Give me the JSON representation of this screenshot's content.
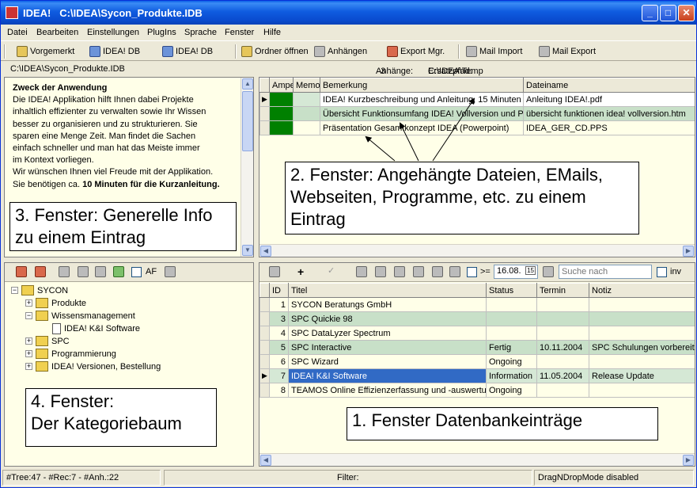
{
  "window": {
    "app_name": "IDEA!",
    "file_path": "C:\\IDEA\\Sycon_Produkte.IDB",
    "minimize": "_",
    "maximize": "□",
    "close": "✕"
  },
  "menu": [
    "Datei",
    "Bearbeiten",
    "Einstellungen",
    "PlugIns",
    "Sprache",
    "Fenster",
    "Hilfe"
  ],
  "toolbar": {
    "vorgemerkt": "Vorgemerkt",
    "idea_db_1": "IDEA! DB",
    "idea_db_2": "IDEA! DB",
    "ordner_oeffnen": "Ordner öffnen",
    "anhaengen": "Anhängen",
    "export_mgr": "Export Mgr.",
    "mail_import": "Mail Import",
    "mail_export": "Mail Export"
  },
  "infobar": {
    "path": "C:\\IDEA\\Sycon_Produkte.IDB",
    "anhaenge_label": "Anhänge:",
    "anhaenge_count": "3",
    "ersatzpfad_label": "Ersatzpfad:",
    "ersatzpfad_value": "C:\\IDEA\\Temp"
  },
  "notes": {
    "heading": "Zweck der Anwendung",
    "lines": [
      "Die IDEA! Applikation hilft Ihnen dabei Projekte",
      "inhaltlich effizienter zu verwalten sowie Ihr Wissen",
      "besser zu organisieren und zu strukturieren. Sie",
      "sparen eine Menge Zeit. Man findet die Sachen",
      "einfach schneller und man hat das Meiste immer",
      "im Kontext vorliegen.",
      "Wir wünschen Ihnen viel Freude mit der Applikation."
    ],
    "last_line_prefix": "Sie benötigen ca. ",
    "last_line_bold": "10 Minuten für die Kurzanleitung."
  },
  "attachments": {
    "columns": [
      "Ampel",
      "Memo",
      "Bemerkung",
      "Dateiname"
    ],
    "rows": [
      {
        "bemerkung": "IDEA! Kurzbeschreibung und Anleitung, 15 Minuten",
        "dateiname": "Anleitung IDEA!.pdf"
      },
      {
        "bemerkung": "Übersicht Funktionsumfang IDEA! Vollversion und Pre",
        "dateiname": "übersicht funktionen idea! vollversion.htm"
      },
      {
        "bemerkung": "Präsentation Gesamtkonzept IDEA (Powerpoint)",
        "dateiname": "IDEA_GER_CD.PPS"
      }
    ]
  },
  "callouts": {
    "fenster1": "1. Fenster Datenbankeinträge",
    "fenster2_l1": "2. Fenster: Angehängte Dateien, EMails,",
    "fenster2_l2": "Webseiten, Programme, etc. zu einem",
    "fenster2_l3": "Eintrag",
    "fenster3_l1": "3. Fenster: Generelle Info",
    "fenster3_l2": "zu einem Eintrag",
    "fenster4_l1": "4. Fenster:",
    "fenster4_l2": "Der Kategoriebaum"
  },
  "tree": {
    "af_label": "AF",
    "root": "SYCON",
    "items": [
      "Produkte",
      "Wissensmanagement",
      "IDEA! K&I Software",
      "SPC",
      "Programmierung",
      "IDEA! Versionen, Bestellung"
    ]
  },
  "filter": {
    "ge_label": ">=",
    "date": "16.08.",
    "calendar": "15",
    "search_placeholder": "Suche nach",
    "inv_label": "inv"
  },
  "records": {
    "columns": [
      "ID",
      "Titel",
      "Status",
      "Termin",
      "Notiz"
    ],
    "rows": [
      {
        "id": "1",
        "titel": "SYCON Beratungs GmbH",
        "status": "",
        "termin": "",
        "notiz": ""
      },
      {
        "id": "3",
        "titel": "SPC Quickie 98",
        "status": "",
        "termin": "",
        "notiz": ""
      },
      {
        "id": "4",
        "titel": "SPC DataLyzer Spectrum",
        "status": "",
        "termin": "",
        "notiz": ""
      },
      {
        "id": "5",
        "titel": "SPC Interactive",
        "status": "Fertig",
        "termin": "10.11.2004",
        "notiz": "SPC Schulungen vorbereiten"
      },
      {
        "id": "6",
        "titel": "SPC Wizard",
        "status": "Ongoing",
        "termin": "",
        "notiz": ""
      },
      {
        "id": "7",
        "titel": "IDEA! K&I Software",
        "status": "Information",
        "termin": "11.05.2004",
        "notiz": "Release Update"
      },
      {
        "id": "8",
        "titel": "TEAMOS Online Effizienzerfassung und -auswertung",
        "status": "Ongoing",
        "termin": "",
        "notiz": ""
      }
    ]
  },
  "statusbar": {
    "counts": "#Tree:47 - #Rec:7 - #Anh.:22",
    "filter_label": "Filter:",
    "dragdrop": "DragNDropMode disabled"
  },
  "colors": {
    "title_gradient": "#0a4cd0",
    "pane_background": "#ffffe8",
    "row_alt": "#c8e0c8",
    "selection": "#316ac5",
    "ampel_green": "#008000"
  }
}
